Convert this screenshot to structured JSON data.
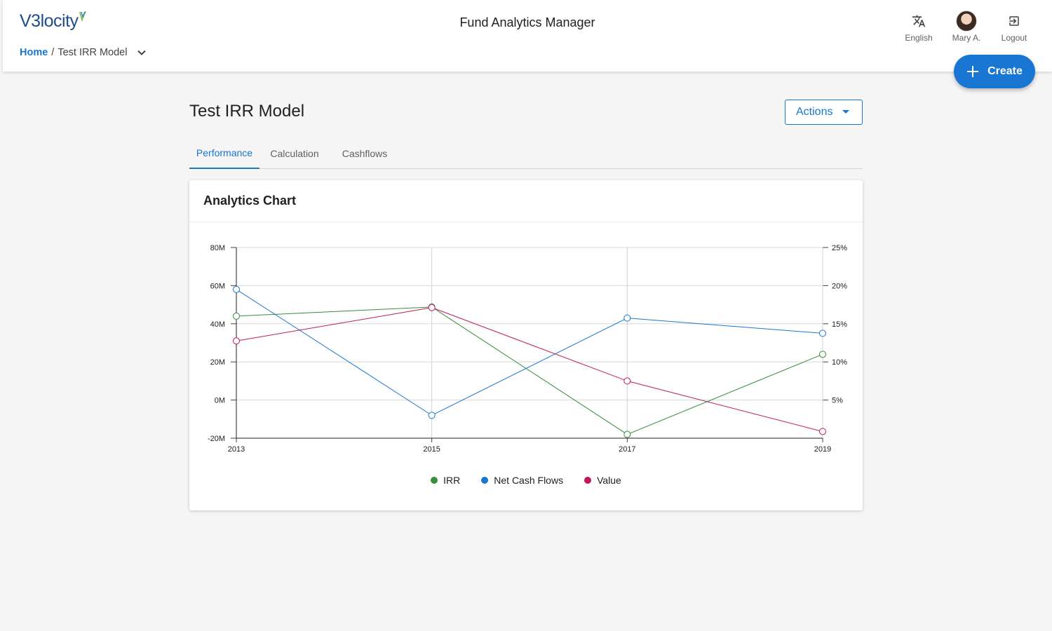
{
  "header": {
    "logo_text": "V3locity",
    "app_title": "Fund Analytics Manager",
    "breadcrumb": {
      "home": "Home",
      "separator": "/",
      "current": "Test IRR Model"
    },
    "actions": [
      {
        "label": "English",
        "icon": "translate-icon"
      },
      {
        "label": "Mary A.",
        "icon": "avatar"
      },
      {
        "label": "Logout",
        "icon": "logout-icon"
      }
    ],
    "create_label": "Create"
  },
  "page": {
    "title": "Test IRR Model",
    "actions_label": "Actions",
    "tabs": [
      {
        "label": "Performance",
        "active": true
      },
      {
        "label": "Calculation",
        "active": false
      },
      {
        "label": "Cashflows",
        "active": false
      }
    ]
  },
  "card": {
    "title": "Analytics Chart"
  },
  "colors": {
    "primary": "#1976d2",
    "irr": "#388e3c",
    "net": "#1976d2",
    "value": "#c2185b"
  },
  "chart_data": {
    "type": "line",
    "x": [
      "2013",
      "2015",
      "2017",
      "2019"
    ],
    "y_left": {
      "min": -20,
      "max": 80,
      "ticks": [
        "80M",
        "60M",
        "40M",
        "20M",
        "0M",
        "-20M"
      ]
    },
    "y_right": {
      "min": 0,
      "max": 25,
      "ticks": [
        "25%",
        "20%",
        "15%",
        "10%",
        "5%"
      ]
    },
    "grid": true,
    "legend_position": "bottom",
    "series": [
      {
        "name": "IRR",
        "axis": "right",
        "color": "#388e3c",
        "values": [
          16.0,
          17.2,
          0.5,
          11.0
        ]
      },
      {
        "name": "Net Cash Flows",
        "axis": "left",
        "color": "#1976d2",
        "values": [
          58.0,
          -8.0,
          43.0,
          35.0
        ]
      },
      {
        "name": "Value",
        "axis": "left",
        "color": "#c2185b",
        "values": [
          31.0,
          48.5,
          10.0,
          -16.5
        ]
      }
    ]
  }
}
